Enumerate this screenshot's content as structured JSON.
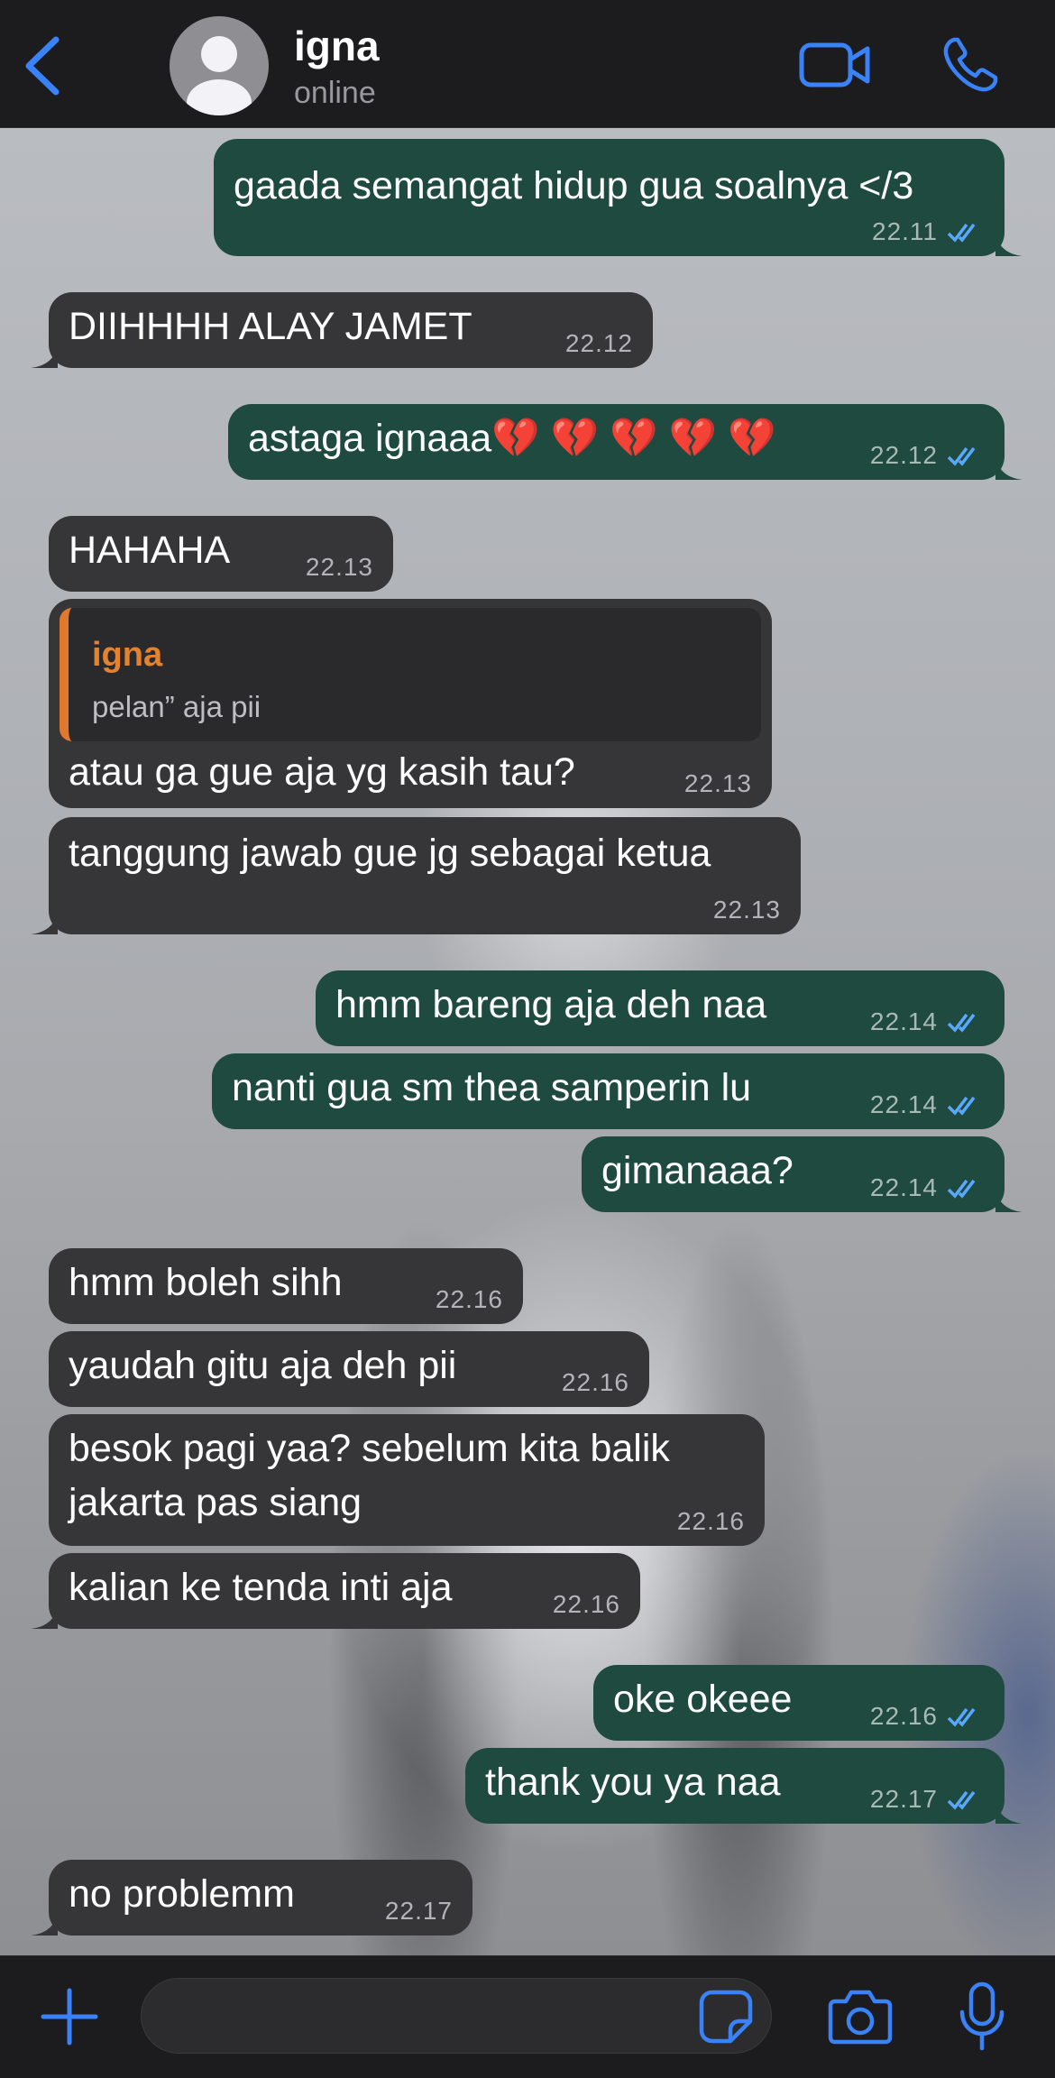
{
  "header": {
    "contact_name": "igna",
    "status": "online"
  },
  "colors": {
    "accent_blue": "#3a82f7",
    "incoming_bubble": "#363638",
    "outgoing_bubble": "#1e4a3f",
    "read_ticks": "#5aa7ff",
    "reply_name": "#e4832f"
  },
  "messages": [
    {
      "dir": "out",
      "text": "gaada semangat hidup gua soalnya </3",
      "time": "22.11",
      "read": true
    },
    {
      "dir": "in",
      "text": "DIIHHHH ALAY JAMET",
      "time": "22.12"
    },
    {
      "dir": "out",
      "text": "astaga ignaaa💔 💔 💔 💔 💔",
      "time": "22.12",
      "read": true
    },
    {
      "dir": "in",
      "text": "HAHAHA",
      "time": "22.13"
    },
    {
      "dir": "in",
      "text": "atau ga gue aja yg kasih tau?",
      "time": "22.13",
      "reply": {
        "name": "igna",
        "text": "pelan” aja pii"
      }
    },
    {
      "dir": "in",
      "text": "tanggung jawab gue jg sebagai ketua",
      "time": "22.13"
    },
    {
      "dir": "out",
      "text": "hmm bareng aja deh naa",
      "time": "22.14",
      "read": true
    },
    {
      "dir": "out",
      "text": "nanti gua sm thea samperin lu",
      "time": "22.14",
      "read": true
    },
    {
      "dir": "out",
      "text": "gimanaaa?",
      "time": "22.14",
      "read": true
    },
    {
      "dir": "in",
      "text": "hmm boleh sihh",
      "time": "22.16"
    },
    {
      "dir": "in",
      "text": "yaudah gitu aja deh pii",
      "time": "22.16"
    },
    {
      "dir": "in",
      "text": "besok pagi yaa? sebelum kita balik\njakarta pas siang",
      "time": "22.16"
    },
    {
      "dir": "in",
      "text": "kalian ke tenda inti aja",
      "time": "22.16"
    },
    {
      "dir": "out",
      "text": "oke okeee",
      "time": "22.16",
      "read": true
    },
    {
      "dir": "out",
      "text": "thank you ya naa",
      "time": "22.17",
      "read": true
    },
    {
      "dir": "in",
      "text": "no problemm",
      "time": "22.17"
    }
  ],
  "icons": {
    "back": "chevron-left-icon",
    "video": "video-camera-icon",
    "call": "phone-icon",
    "attach": "plus-icon",
    "sticker": "sticker-icon",
    "camera": "camera-icon",
    "mic": "microphone-icon"
  },
  "input": {
    "value": "",
    "placeholder": ""
  }
}
